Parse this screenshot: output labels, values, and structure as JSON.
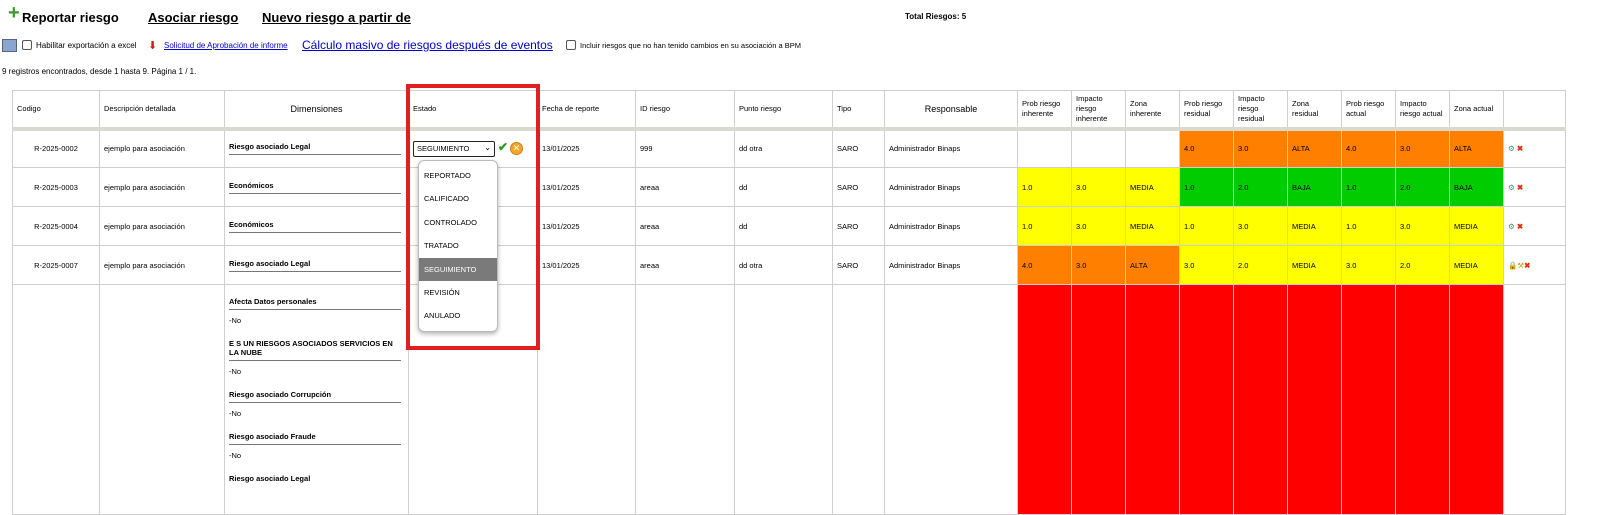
{
  "toolbar": {
    "reportar": "Reportar riesgo",
    "asociar": "Asociar riesgo",
    "nuevo": "Nuevo riesgo a partir de",
    "total": "Total Riesgos: 5"
  },
  "options": {
    "excel": "Habilitar exportación a excel",
    "solicitud": "Solicitud de Aprobación de informe",
    "calculo": "Cálculo masivo de riesgos después de eventos",
    "incluir": "Incluir riesgos que no han tenido cambios en su asociación a BPM"
  },
  "info": "9 registros encontrados, desde 1 hasta 9. Página 1 / 1.",
  "headers": {
    "codigo": "Codigo",
    "descripcion": "Descripción detallada",
    "dimensiones": "Dimensiones",
    "estado": "Estado",
    "fecha": "Fecha de reporte",
    "id": "ID riesgo",
    "punto": "Punto riesgo",
    "tipo": "Tipo",
    "responsable": "Responsable",
    "pri": "Prob riesgo inherente",
    "iri": "Impacto riesgo inherente",
    "zi": "Zona inherente",
    "prr": "Prob riesgo residual",
    "irr": "Impacto riesgo residual",
    "zr": "Zona residual",
    "pra": "Prob riesgo actual",
    "ira": "Impacto riesgo actual",
    "za": "Zona actual"
  },
  "rows": [
    {
      "codigo": "R-2025-0002",
      "desc": "ejemplo para asociación",
      "dim": "Riesgo asociado Legal",
      "fecha": "13/01/2025",
      "id": "999",
      "punto": "dd otra",
      "tipo": "SARO",
      "resp": "Administrador Binaps",
      "pri": "",
      "iri": "",
      "zi": "",
      "prr": "4.0",
      "irr": "3.0",
      "zr": "ALTA",
      "pra": "4.0",
      "ira": "3.0",
      "za": "ALTA"
    },
    {
      "codigo": "R-2025-0003",
      "desc": "ejemplo para asociación",
      "dim": "Económicos",
      "fecha": "13/01/2025",
      "id": "areaa",
      "punto": "dd",
      "tipo": "SARO",
      "resp": "Administrador Binaps",
      "pri": "1.0",
      "iri": "3.0",
      "zi": "MEDIA",
      "prr": "1.0",
      "irr": "2.0",
      "zr": "BAJA",
      "pra": "1.0",
      "ira": "2.0",
      "za": "BAJA"
    },
    {
      "codigo": "R-2025-0004",
      "desc": "ejemplo para asociación",
      "dim": "Económicos",
      "fecha": "13/01/2025",
      "id": "areaa",
      "punto": "dd",
      "tipo": "SARO",
      "resp": "Administrador Binaps",
      "pri": "1.0",
      "iri": "3.0",
      "zi": "MEDIA",
      "prr": "1.0",
      "irr": "3.0",
      "zr": "MEDIA",
      "pra": "1.0",
      "ira": "3.0",
      "za": "MEDIA"
    },
    {
      "codigo": "R-2025-0007",
      "desc": "ejemplo para asociación",
      "dim": "Riesgo asociado Legal",
      "fecha": "13/01/2025",
      "id": "areaa",
      "punto": "dd otra",
      "tipo": "SARO",
      "resp": "Administrador Binaps",
      "pri": "4.0",
      "iri": "3.0",
      "zi": "ALTA",
      "prr": "3.0",
      "irr": "2.0",
      "zr": "MEDIA",
      "pra": "3.0",
      "ira": "2.0",
      "za": "MEDIA"
    }
  ],
  "estado_selected": "SEGUIMIENTO",
  "estado_options": [
    "REPORTADO",
    "CALIFICADO",
    "CONTROLADO",
    "TRATADO",
    "SEGUIMIENTO",
    "REVISIÓN",
    "ANULADO"
  ],
  "dim_block": {
    "d1": "Afecta Datos personales",
    "v1": "-No",
    "d2": "E S UN RIESGOS ASOCIADOS SERVICIOS EN LA NUBE",
    "v2": "-No",
    "d3": "Riesgo asociado Corrupción",
    "v3": "-No",
    "d4": "Riesgo asociado Fraude",
    "v4": "-No",
    "d5": "Riesgo asociado Legal"
  },
  "colors": {
    "orange": "#ff8000",
    "yellow": "#ffff00",
    "green": "#00cc00",
    "red": "#ff0000",
    "highlight": "#e02020"
  }
}
